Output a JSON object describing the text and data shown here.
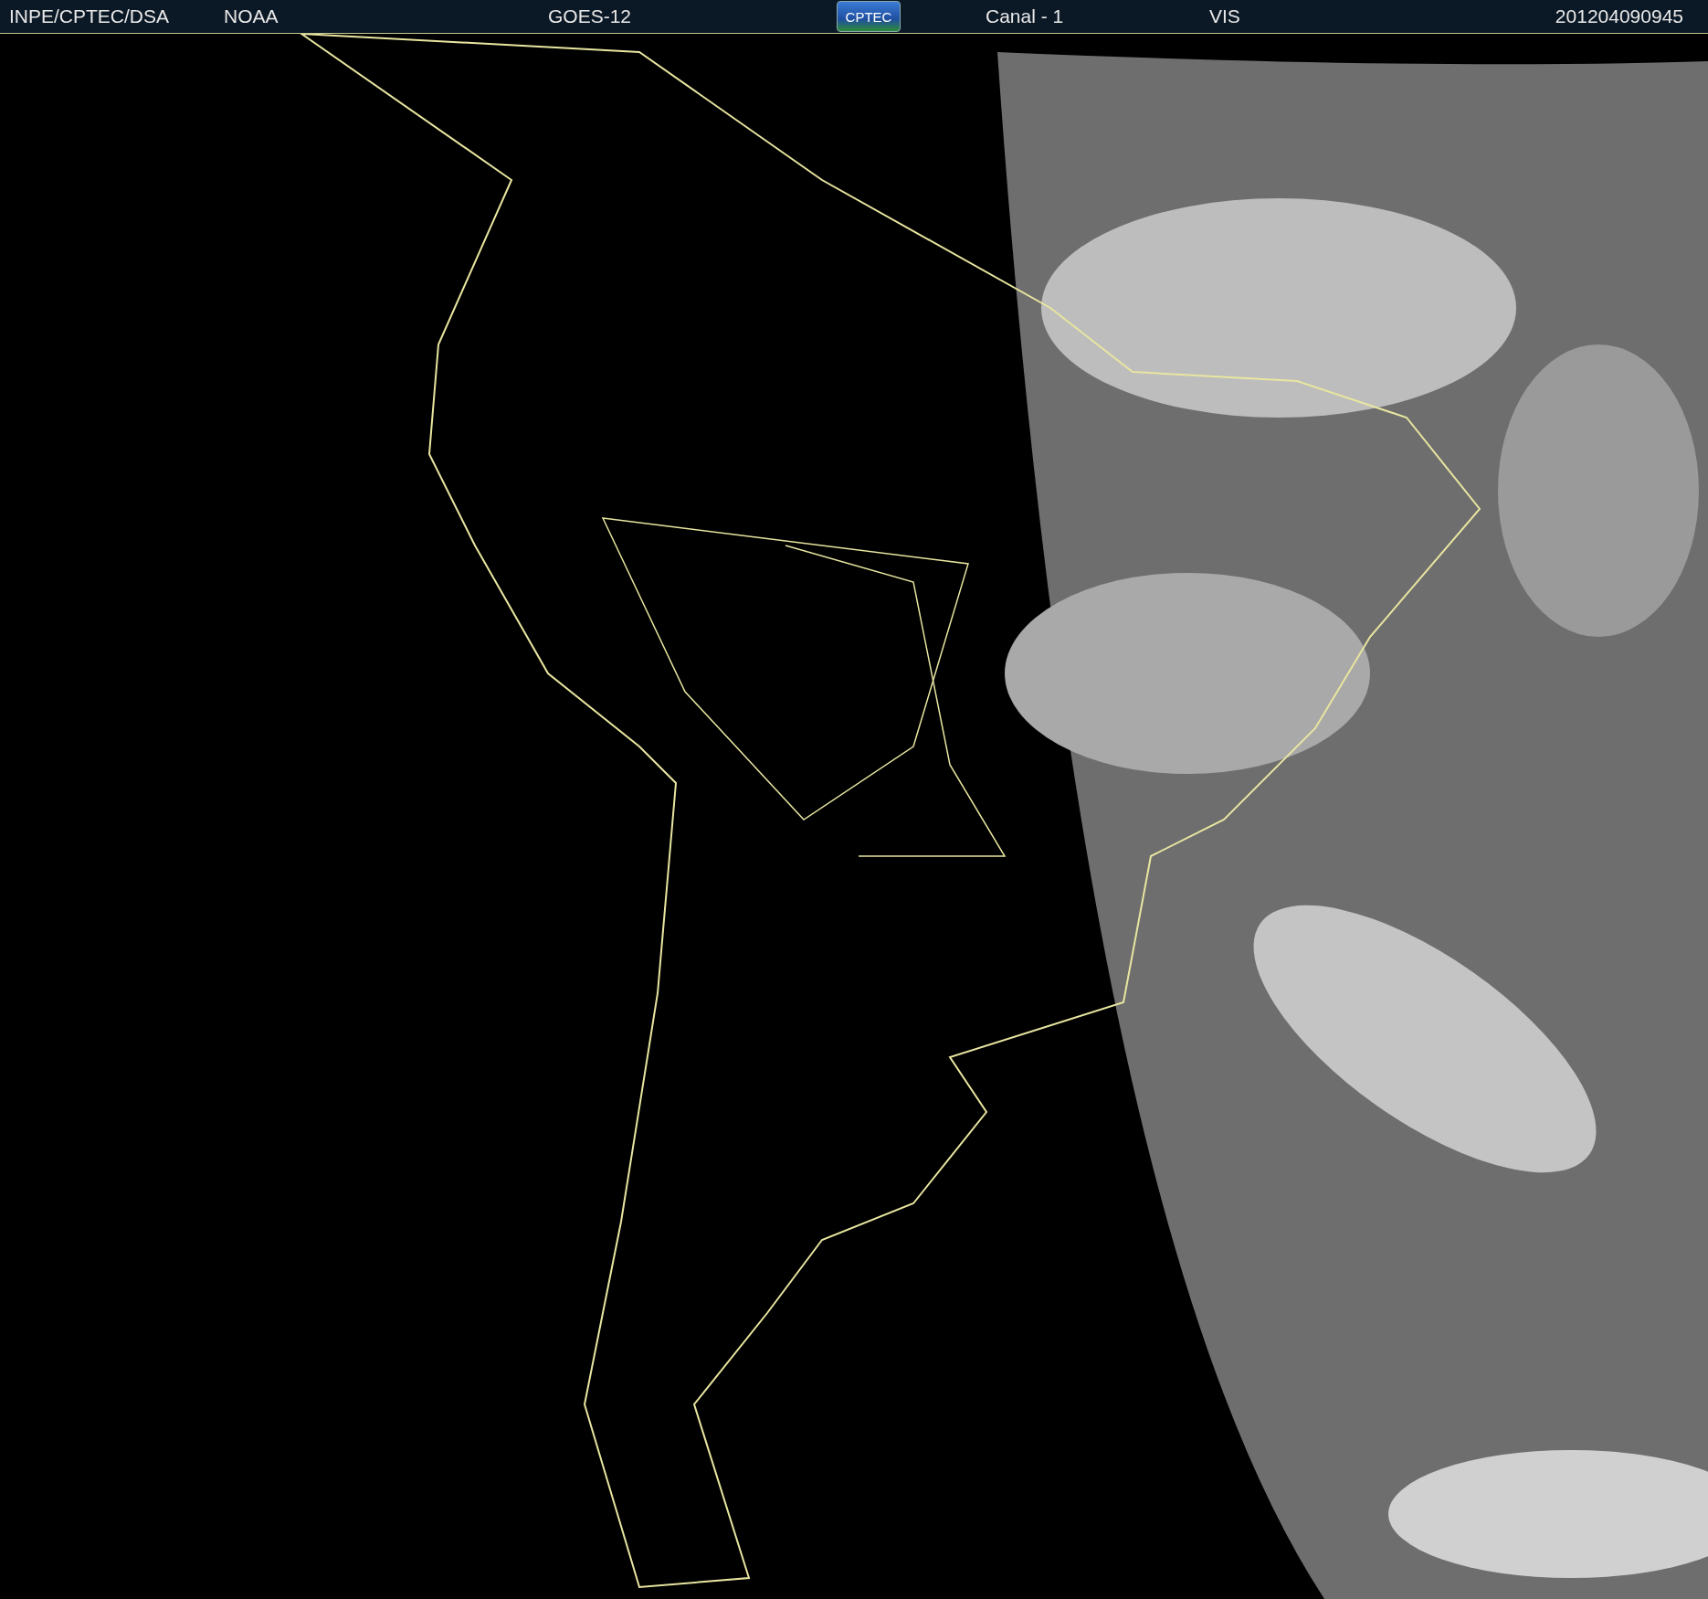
{
  "header": {
    "source": "INPE/CPTEC/DSA",
    "agency": "NOAA",
    "satellite": "GOES-12",
    "logo": "CPTEC",
    "channel": "Canal - 1",
    "band": "VIS",
    "timestamp": "201204090945"
  }
}
